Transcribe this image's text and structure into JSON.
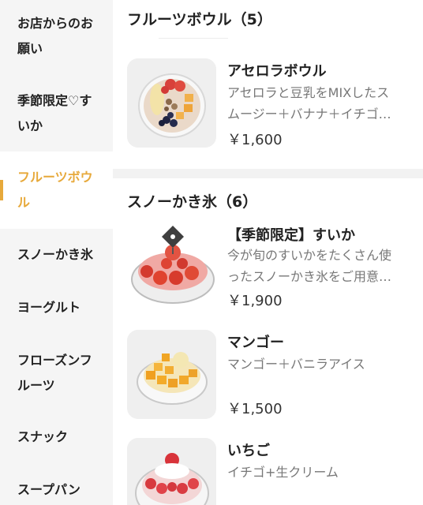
{
  "sidebar": {
    "items": [
      {
        "line1": "お店からのお",
        "line2": "願い"
      },
      {
        "line1": "季節限定♡す",
        "line2": "いか"
      },
      {
        "line1": "フルーツボウ",
        "line2": "ル"
      },
      {
        "line1": "スノーかき氷",
        "line2": ""
      },
      {
        "line1": "ヨーグルト",
        "line2": ""
      },
      {
        "line1": "フローズンフ",
        "line2": "ルーツ"
      },
      {
        "line1": "スナック",
        "line2": ""
      },
      {
        "line1": "スープパン",
        "line2": ""
      }
    ],
    "active_index": 2,
    "accent": "#e7a93b"
  },
  "sections": [
    {
      "title": "フルーツボウル（5）",
      "items": [
        {
          "name": "アセロラボウル",
          "desc_line1": "アセロラと豆乳をMIXしたス",
          "desc_line2": "ムージー＋バナナ＋イチゴ…",
          "price": "￥1,600",
          "icon": "acerola-bowl-image"
        }
      ]
    },
    {
      "title": "スノーかき氷（6）",
      "items": [
        {
          "name": "【季節限定】すいか",
          "desc_line1": "今が旬のすいかをたくさん使",
          "desc_line2": "ったスノーかき氷をご用意…",
          "price": "￥1,900",
          "icon": "watermelon-shaved-ice-image"
        },
        {
          "name": "マンゴー",
          "desc_line1": "マンゴー＋バニラアイス",
          "desc_line2": "",
          "price": "￥1,500",
          "icon": "mango-shaved-ice-image"
        },
        {
          "name": "いちご",
          "desc_line1": "イチゴ+生クリーム",
          "desc_line2": "",
          "price": "",
          "icon": "strawberry-shaved-ice-image"
        }
      ]
    }
  ]
}
